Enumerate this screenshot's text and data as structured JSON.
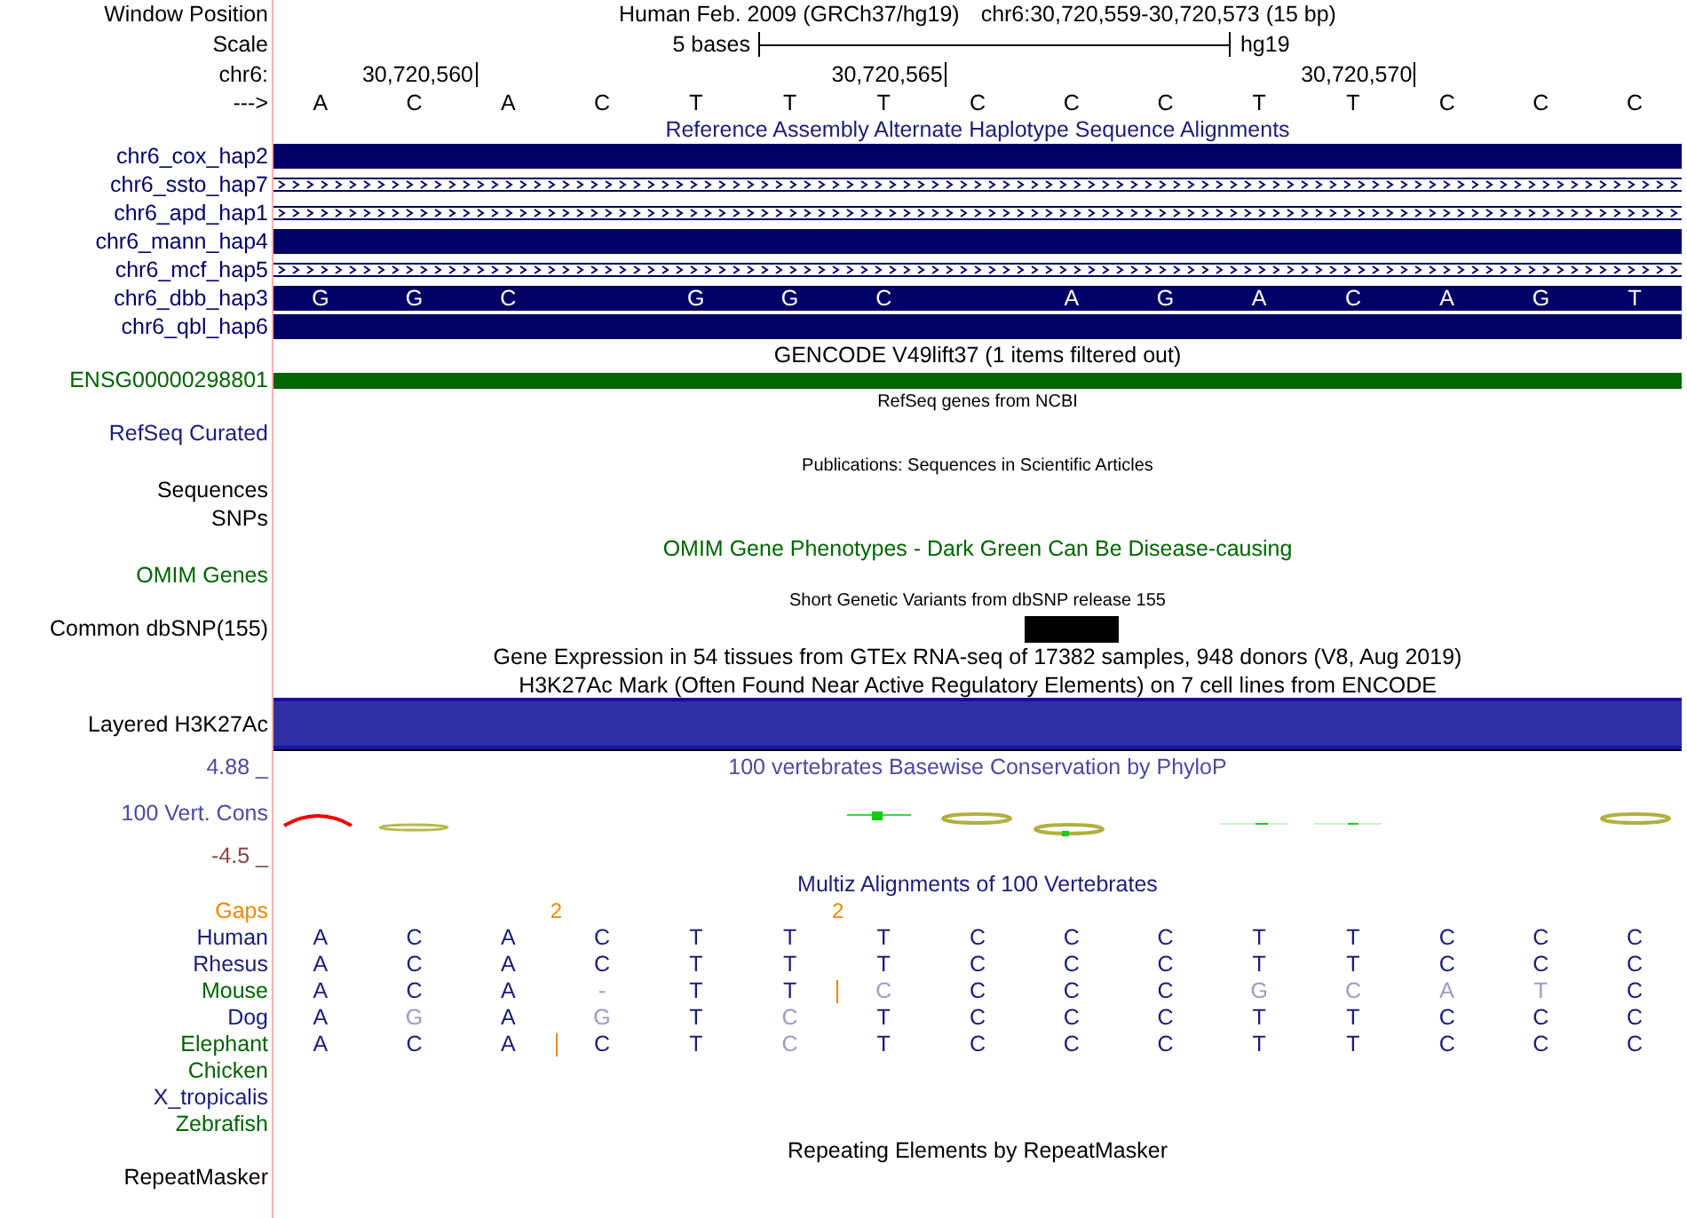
{
  "rows": [
    {
      "kind": "position",
      "label": "Window Position",
      "assembly": "Human Feb. 2009 (GRCh37/hg19)",
      "range": "chr6:30,720,559-30,720,573 (15 bp)"
    },
    {
      "kind": "scale",
      "label": "Scale",
      "span": "5 bases",
      "db": "hg19"
    },
    {
      "kind": "ruler",
      "label": "chr6:",
      "cells": [
        {},
        {
          "text": "30,720,560"
        },
        {},
        {},
        {},
        {},
        {
          "text": "30,720,565"
        },
        {},
        {},
        {},
        {},
        {
          "text": "30,720,570"
        },
        {},
        {},
        {}
      ]
    },
    {
      "kind": "sequence",
      "label": "--->",
      "bases": [
        "A",
        "C",
        "A",
        "C",
        "T",
        "T",
        "T",
        "C",
        "C",
        "C",
        "T",
        "T",
        "C",
        "C",
        "C"
      ]
    },
    {
      "kind": "title",
      "text": "Reference Assembly Alternate Haplotype Sequence Alignments",
      "color": "#1c1c78"
    },
    {
      "kind": "bar",
      "label": "chr6_cox_hap2",
      "color": "#000066"
    },
    {
      "kind": "strand",
      "label": "chr6_ssto_hap7",
      "color": "#000066"
    },
    {
      "kind": "strand",
      "label": "chr6_apd_hap1",
      "color": "#000066"
    },
    {
      "kind": "bar",
      "label": "chr6_mann_hap4",
      "color": "#000066"
    },
    {
      "kind": "strand",
      "label": "chr6_mcf_hap5",
      "color": "#000066"
    },
    {
      "kind": "bar",
      "label": "chr6_dbb_hap3",
      "color": "#000066",
      "cells": [
        {
          "base": "G"
        },
        {
          "base": "G"
        },
        {
          "base": "C"
        },
        {},
        {
          "base": "G"
        },
        {
          "base": "G"
        },
        {
          "base": "C"
        },
        {},
        {
          "base": "A"
        },
        {
          "base": "G"
        },
        {
          "base": "A"
        },
        {
          "base": "C"
        },
        {
          "base": "A"
        },
        {
          "base": "G"
        },
        {
          "base": "T"
        }
      ]
    },
    {
      "kind": "bar",
      "label": "chr6_qbl_hap6",
      "color": "#000066"
    },
    {
      "kind": "title",
      "text": "GENCODE V49lift37 (1 items filtered out)",
      "color": "#000000"
    },
    {
      "kind": "bar",
      "label": "ENSG00000298801",
      "color": "#006400"
    },
    {
      "kind": "note",
      "text": "RefSeq genes from NCBI",
      "color": "#000000"
    },
    {
      "kind": "label",
      "label": "RefSeq Curated",
      "color": "#1c1c78"
    },
    {
      "kind": "note",
      "text": "Publications: Sequences in Scientific Articles",
      "color": "#000000"
    },
    {
      "kind": "label",
      "label": "Sequences",
      "color": "#000000"
    },
    {
      "kind": "label",
      "label": "SNPs",
      "color": "#000000"
    },
    {
      "kind": "title",
      "text": "OMIM Gene Phenotypes - Dark Green Can Be Disease-causing",
      "color": "#006400"
    },
    {
      "kind": "label",
      "label": "OMIM Genes",
      "color": "#006400"
    },
    {
      "kind": "note",
      "text": "Short Genetic Variants from dbSNP release 155",
      "color": "#000000"
    },
    {
      "kind": "snp",
      "label": "Common dbSNP(155)",
      "color": "#000000",
      "cells": [
        {
          "kind": "empty"
        },
        {
          "kind": "empty"
        },
        {
          "kind": "empty"
        },
        {
          "kind": "empty"
        },
        {
          "kind": "empty"
        },
        {
          "kind": "empty"
        },
        {
          "kind": "empty"
        },
        {
          "kind": "empty"
        },
        {
          "kind": "variant"
        },
        {
          "kind": "empty"
        },
        {
          "kind": "empty"
        },
        {
          "kind": "empty"
        },
        {
          "kind": "empty"
        },
        {
          "kind": "empty"
        },
        {
          "kind": "empty"
        }
      ]
    },
    {
      "kind": "title",
      "text": "Gene Expression in 54 tissues from GTEx RNA-seq of 17382 samples, 948 donors (V8, Aug 2019)",
      "color": "#000000"
    },
    {
      "kind": "title",
      "text": "H3K27Ac Mark (Often Found Near Active Regulatory Elements) on 7 cell lines from ENCODE",
      "color": "#000000"
    },
    {
      "kind": "layered",
      "label": "Layered H3K27Ac",
      "color": "#000000"
    },
    {
      "kind": "axis_title",
      "label": "4.88 _",
      "text": "100 vertebrates Basewise Conservation by PhyloP",
      "color": "#4b4b9e"
    },
    {
      "kind": "wiggle",
      "label": "100 Vert. Cons",
      "color": "#4b4b9e"
    },
    {
      "kind": "label",
      "label": "-4.5 _",
      "color": "#884444"
    },
    {
      "kind": "title",
      "text": "Multiz Alignments of 100 Vertebrates",
      "color": "#1c1c78"
    },
    {
      "kind": "gaps",
      "label": "Gaps",
      "color": "#ee8800",
      "cells": [
        {},
        {},
        {
          "count": "2"
        },
        {},
        {},
        {
          "count": "2"
        },
        {},
        {},
        {},
        {},
        {},
        {},
        {},
        {},
        {}
      ]
    },
    {
      "kind": "species",
      "label": "Human",
      "color": "#1c1c78",
      "bases": [
        {
          "base": "A",
          "match": true,
          "insert": false
        },
        {
          "base": "C",
          "match": true,
          "insert": false
        },
        {
          "base": "A",
          "match": true,
          "insert": false
        },
        {
          "base": "C",
          "match": true,
          "insert": false
        },
        {
          "base": "T",
          "match": true,
          "insert": false
        },
        {
          "base": "T",
          "match": true,
          "insert": false
        },
        {
          "base": "T",
          "match": true,
          "insert": false
        },
        {
          "base": "C",
          "match": true,
          "insert": false
        },
        {
          "base": "C",
          "match": true,
          "insert": false
        },
        {
          "base": "C",
          "match": true,
          "insert": false
        },
        {
          "base": "T",
          "match": true,
          "insert": false
        },
        {
          "base": "T",
          "match": true,
          "insert": false
        },
        {
          "base": "C",
          "match": true,
          "insert": false
        },
        {
          "base": "C",
          "match": true,
          "insert": false
        },
        {
          "base": "C",
          "match": true,
          "insert": false
        }
      ]
    },
    {
      "kind": "species",
      "label": "Rhesus",
      "color": "#1c1c78",
      "bases": [
        {
          "base": "A",
          "match": true,
          "insert": false
        },
        {
          "base": "C",
          "match": true,
          "insert": false
        },
        {
          "base": "A",
          "match": true,
          "insert": false
        },
        {
          "base": "C",
          "match": true,
          "insert": false
        },
        {
          "base": "T",
          "match": true,
          "insert": false
        },
        {
          "base": "T",
          "match": true,
          "insert": false
        },
        {
          "base": "T",
          "match": true,
          "insert": false
        },
        {
          "base": "C",
          "match": true,
          "insert": false
        },
        {
          "base": "C",
          "match": true,
          "insert": false
        },
        {
          "base": "C",
          "match": true,
          "insert": false
        },
        {
          "base": "T",
          "match": true,
          "insert": false
        },
        {
          "base": "T",
          "match": true,
          "insert": false
        },
        {
          "base": "C",
          "match": true,
          "insert": false
        },
        {
          "base": "C",
          "match": true,
          "insert": false
        },
        {
          "base": "C",
          "match": true,
          "insert": false
        }
      ]
    },
    {
      "kind": "species",
      "label": "Mouse",
      "color": "#006400",
      "bases": [
        {
          "base": "A",
          "match": true,
          "insert": false
        },
        {
          "base": "C",
          "match": true,
          "insert": false
        },
        {
          "base": "A",
          "match": true,
          "insert": false
        },
        {
          "base": "-",
          "match": false,
          "insert": false
        },
        {
          "base": "T",
          "match": true,
          "insert": false
        },
        {
          "base": "T",
          "match": true,
          "insert": true
        },
        {
          "base": "C",
          "match": false,
          "insert": false
        },
        {
          "base": "C",
          "match": true,
          "insert": false
        },
        {
          "base": "C",
          "match": true,
          "insert": false
        },
        {
          "base": "C",
          "match": true,
          "insert": false
        },
        {
          "base": "G",
          "match": false,
          "insert": false
        },
        {
          "base": "C",
          "match": false,
          "insert": false
        },
        {
          "base": "A",
          "match": false,
          "insert": false
        },
        {
          "base": "T",
          "match": false,
          "insert": false
        },
        {
          "base": "C",
          "match": true,
          "insert": false
        }
      ]
    },
    {
      "kind": "species",
      "label": "Dog",
      "color": "#1c1c78",
      "bases": [
        {
          "base": "A",
          "match": true,
          "insert": false
        },
        {
          "base": "G",
          "match": false,
          "insert": false
        },
        {
          "base": "A",
          "match": true,
          "insert": false
        },
        {
          "base": "G",
          "match": false,
          "insert": false
        },
        {
          "base": "T",
          "match": true,
          "insert": false
        },
        {
          "base": "C",
          "match": false,
          "insert": false
        },
        {
          "base": "T",
          "match": true,
          "insert": false
        },
        {
          "base": "C",
          "match": true,
          "insert": false
        },
        {
          "base": "C",
          "match": true,
          "insert": false
        },
        {
          "base": "C",
          "match": true,
          "insert": false
        },
        {
          "base": "T",
          "match": true,
          "insert": false
        },
        {
          "base": "T",
          "match": true,
          "insert": false
        },
        {
          "base": "C",
          "match": true,
          "insert": false
        },
        {
          "base": "C",
          "match": true,
          "insert": false
        },
        {
          "base": "C",
          "match": true,
          "insert": false
        }
      ]
    },
    {
      "kind": "species",
      "label": "Elephant",
      "color": "#006400",
      "bases": [
        {
          "base": "A",
          "match": true,
          "insert": false
        },
        {
          "base": "C",
          "match": true,
          "insert": false
        },
        {
          "base": "A",
          "match": true,
          "insert": true
        },
        {
          "base": "C",
          "match": true,
          "insert": false
        },
        {
          "base": "T",
          "match": true,
          "insert": false
        },
        {
          "base": "C",
          "match": false,
          "insert": false
        },
        {
          "base": "T",
          "match": true,
          "insert": false
        },
        {
          "base": "C",
          "match": true,
          "insert": false
        },
        {
          "base": "C",
          "match": true,
          "insert": false
        },
        {
          "base": "C",
          "match": true,
          "insert": false
        },
        {
          "base": "T",
          "match": true,
          "insert": false
        },
        {
          "base": "T",
          "match": true,
          "insert": false
        },
        {
          "base": "C",
          "match": true,
          "insert": false
        },
        {
          "base": "C",
          "match": true,
          "insert": false
        },
        {
          "base": "C",
          "match": true,
          "insert": false
        }
      ]
    },
    {
      "kind": "species",
      "label": "Chicken",
      "color": "#006400"
    },
    {
      "kind": "species",
      "label": "X_tropicalis",
      "color": "#1c1c78"
    },
    {
      "kind": "species",
      "label": "Zebrafish",
      "color": "#006400"
    },
    {
      "kind": "title",
      "text": "Repeating Elements by RepeatMasker",
      "color": "#000000"
    },
    {
      "kind": "label",
      "label": "RepeatMasker",
      "color": "#000000"
    }
  ]
}
